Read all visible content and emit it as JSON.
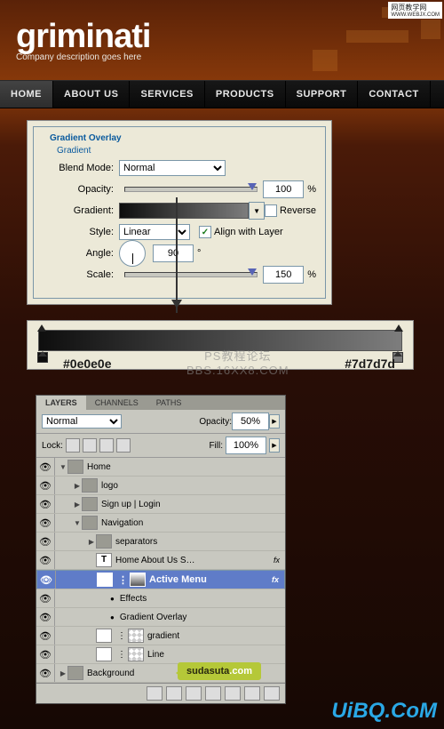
{
  "watermarks": {
    "top_line1": "网页教学网",
    "top_line2": "WWW.WEBJX.COM",
    "mid1": "PS教程论坛",
    "mid2": "BBS.16XX8.COM",
    "sudasuta": "sudasuta",
    "sudasuta_ext": ".com",
    "uibq": "UiBQ.CoM"
  },
  "logo": {
    "name": "griminati",
    "tagline": "Company description goes here"
  },
  "nav": {
    "items": [
      "HOME",
      "ABOUT US",
      "SERVICES",
      "PRODUCTS",
      "SUPPORT",
      "CONTACT"
    ],
    "active": 0
  },
  "dialog": {
    "title": "Gradient Overlay",
    "subtitle": "Gradient",
    "blend_mode_label": "Blend Mode:",
    "blend_mode_value": "Normal",
    "opacity_label": "Opacity:",
    "opacity_value": "100",
    "pct": "%",
    "gradient_label": "Gradient:",
    "reverse_label": "Reverse",
    "reverse_checked": false,
    "style_label": "Style:",
    "style_value": "Linear",
    "align_label": "Align with Layer",
    "align_checked": true,
    "angle_label": "Angle:",
    "angle_value": "90",
    "deg": "°",
    "scale_label": "Scale:",
    "scale_value": "150"
  },
  "gradient_editor": {
    "left_hex": "#0e0e0e",
    "right_hex": "#7d7d7d"
  },
  "layers_panel": {
    "tabs": [
      "LAYERS",
      "CHANNELS",
      "PATHS"
    ],
    "active_tab": 0,
    "blend_value": "Normal",
    "opacity_label": "Opacity:",
    "opacity_value": "50%",
    "lock_label": "Lock:",
    "fill_label": "Fill:",
    "fill_value": "100%",
    "rows": [
      {
        "depth": 0,
        "icon": "folder",
        "eye": true,
        "tw": "▼",
        "label": "Home"
      },
      {
        "depth": 1,
        "icon": "folder",
        "eye": true,
        "tw": "▶",
        "label": "logo"
      },
      {
        "depth": 1,
        "icon": "folder",
        "eye": true,
        "tw": "▶",
        "label": "Sign up  |  Login"
      },
      {
        "depth": 1,
        "icon": "folder",
        "eye": true,
        "tw": "▼",
        "label": "Navigation"
      },
      {
        "depth": 2,
        "icon": "folder",
        "eye": true,
        "tw": "▶",
        "label": "separators"
      },
      {
        "depth": 2,
        "icon": "txt",
        "eye": true,
        "tw": "",
        "label": "Home    About Us    S…",
        "fx": "fx"
      },
      {
        "depth": 2,
        "icon": "grad",
        "eye": true,
        "tw": "",
        "label": "Active Menu",
        "selected": true,
        "mask": true,
        "fx": "fx"
      },
      {
        "depth": 3,
        "icon": "",
        "eye": true,
        "tw": "",
        "label": "Effects",
        "bullet": true
      },
      {
        "depth": 3,
        "icon": "",
        "eye": true,
        "tw": "",
        "label": "Gradient Overlay",
        "bullet": true
      },
      {
        "depth": 2,
        "icon": "chk",
        "eye": true,
        "tw": "",
        "label": "gradient",
        "mask": true
      },
      {
        "depth": 2,
        "icon": "chk",
        "eye": true,
        "tw": "",
        "label": "Line",
        "mask": true
      },
      {
        "depth": 0,
        "icon": "folder",
        "eye": true,
        "tw": "▶",
        "label": "Background"
      }
    ]
  }
}
